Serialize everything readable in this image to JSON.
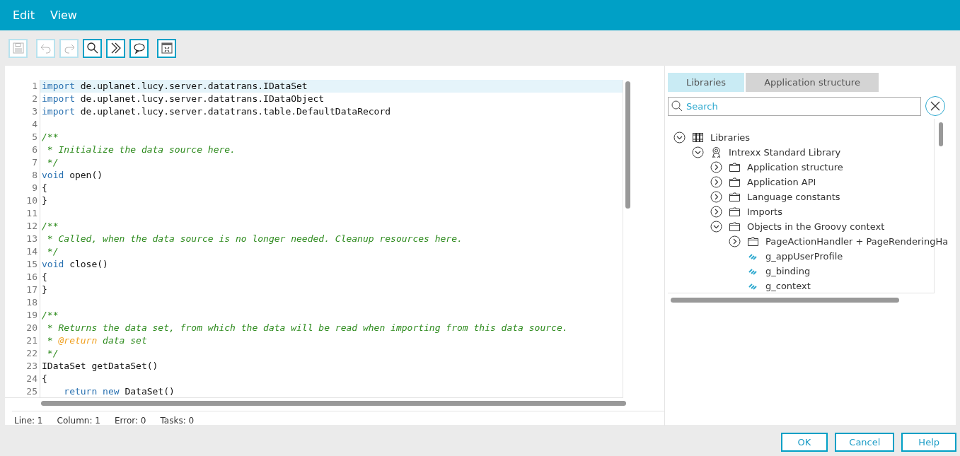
{
  "menu": [
    {
      "label": "Edit"
    },
    {
      "label": "View"
    }
  ],
  "toolbar": {
    "groups": [
      [
        {
          "kind": "save",
          "disabled": true
        }
      ],
      [
        {
          "kind": "undo",
          "disabled": true
        },
        {
          "kind": "redo",
          "disabled": true
        },
        {
          "kind": "search",
          "disabled": false
        },
        {
          "kind": "forward",
          "disabled": false
        },
        {
          "kind": "comment",
          "disabled": false
        }
      ],
      [
        {
          "kind": "dialog",
          "disabled": false
        }
      ]
    ]
  },
  "editor": {
    "lines": [
      {
        "number": "1",
        "selected": true,
        "tokens": [
          {
            "kind": "keyword",
            "text": "import"
          },
          {
            "kind": "plain",
            "text": " de.uplanet.lucy.server.datatrans.IDataSet"
          }
        ]
      },
      {
        "number": "2",
        "selected": false,
        "tokens": [
          {
            "kind": "keyword",
            "text": "import"
          },
          {
            "kind": "plain",
            "text": " de.uplanet.lucy.server.datatrans.IDataObject"
          }
        ]
      },
      {
        "number": "3",
        "selected": false,
        "tokens": [
          {
            "kind": "keyword",
            "text": "import"
          },
          {
            "kind": "plain",
            "text": " de.uplanet.lucy.server.datatrans.table.DefaultDataRecord"
          }
        ]
      },
      {
        "number": "4",
        "selected": false
      },
      {
        "number": "5",
        "selected": false,
        "tokens": [
          {
            "kind": "comment",
            "text": "/**"
          }
        ]
      },
      {
        "number": "6",
        "selected": false,
        "tokens": [
          {
            "kind": "comment",
            "text": " * Initialize the data source here."
          }
        ]
      },
      {
        "number": "7",
        "selected": false,
        "tokens": [
          {
            "kind": "comment",
            "text": " */"
          }
        ]
      },
      {
        "number": "8",
        "selected": false,
        "tokens": [
          {
            "kind": "keyword",
            "text": "void"
          },
          {
            "kind": "plain",
            "text": " open()"
          }
        ]
      },
      {
        "number": "9",
        "selected": false,
        "tokens": [
          {
            "kind": "plain",
            "text": "{"
          }
        ]
      },
      {
        "number": "10",
        "selected": false,
        "tokens": [
          {
            "kind": "plain",
            "text": "}"
          }
        ]
      },
      {
        "number": "11",
        "selected": false
      },
      {
        "number": "12",
        "selected": false,
        "tokens": [
          {
            "kind": "comment",
            "text": "/**"
          }
        ]
      },
      {
        "number": "13",
        "selected": false,
        "tokens": [
          {
            "kind": "comment",
            "text": " * Called, when the data source is no longer needed. Cleanup resources here."
          }
        ]
      },
      {
        "number": "14",
        "selected": false,
        "tokens": [
          {
            "kind": "comment",
            "text": " */"
          }
        ]
      },
      {
        "number": "15",
        "selected": false,
        "tokens": [
          {
            "kind": "keyword",
            "text": "void"
          },
          {
            "kind": "plain",
            "text": " close()"
          }
        ]
      },
      {
        "number": "16",
        "selected": false,
        "tokens": [
          {
            "kind": "plain",
            "text": "{"
          }
        ]
      },
      {
        "number": "17",
        "selected": false,
        "tokens": [
          {
            "kind": "plain",
            "text": "}"
          }
        ]
      },
      {
        "number": "18",
        "selected": false
      },
      {
        "number": "19",
        "selected": false,
        "tokens": [
          {
            "kind": "comment",
            "text": "/**"
          }
        ]
      },
      {
        "number": "20",
        "selected": false,
        "tokens": [
          {
            "kind": "comment",
            "text": " * Returns the data set, from which the data will be read when importing from this data source."
          }
        ]
      },
      {
        "number": "21",
        "selected": false,
        "tokens": [
          {
            "kind": "comment",
            "text": " * "
          },
          {
            "kind": "tag",
            "text": "@return"
          },
          {
            "kind": "comment",
            "text": " data set"
          }
        ]
      },
      {
        "number": "22",
        "selected": false,
        "tokens": [
          {
            "kind": "comment",
            "text": " */"
          }
        ]
      },
      {
        "number": "23",
        "selected": false,
        "tokens": [
          {
            "kind": "plain",
            "text": "IDataSet getDataSet()"
          }
        ]
      },
      {
        "number": "24",
        "selected": false,
        "tokens": [
          {
            "kind": "plain",
            "text": "{"
          }
        ]
      },
      {
        "number": "25",
        "selected": false,
        "tokens": [
          {
            "kind": "keyword",
            "text": "    return new"
          },
          {
            "kind": "plain",
            "text": " DataSet()"
          }
        ]
      }
    ]
  },
  "status_bar": [
    "Line: 1",
    "Column: 1",
    "Error: 0",
    "Tasks: 0"
  ],
  "side_panel": {
    "tabs": [
      {
        "label": "Libraries",
        "selected": true
      },
      {
        "label": "Application structure",
        "selected": false
      }
    ],
    "search": {
      "placeholder": "Search"
    },
    "tree": [
      {
        "label": "Libraries",
        "kind": "libraries",
        "expanded": true,
        "children": [
          {
            "label": "Intrexx Standard Library",
            "kind": "library",
            "expanded": true,
            "children": [
              {
                "label": "Application structure",
                "kind": "folder",
                "expanded": false
              },
              {
                "label": "Application API",
                "kind": "folder",
                "expanded": false
              },
              {
                "label": "Language constants",
                "kind": "folder",
                "expanded": false
              },
              {
                "label": "Imports",
                "kind": "folder",
                "expanded": false
              },
              {
                "label": "Objects in the Groovy context",
                "kind": "folder",
                "expanded": true,
                "children": [
                  {
                    "label": "PageActionHandler + PageRenderingHa",
                    "kind": "folder",
                    "expanded": false
                  },
                  {
                    "label": "g_appUserProfile",
                    "kind": "variable"
                  },
                  {
                    "label": "g_binding",
                    "kind": "variable"
                  },
                  {
                    "label": "g_context",
                    "kind": "variable"
                  }
                ]
              }
            ]
          }
        ]
      }
    ]
  },
  "buttons": [
    {
      "label": "OK"
    },
    {
      "label": "Cancel"
    },
    {
      "label": "Help"
    }
  ]
}
